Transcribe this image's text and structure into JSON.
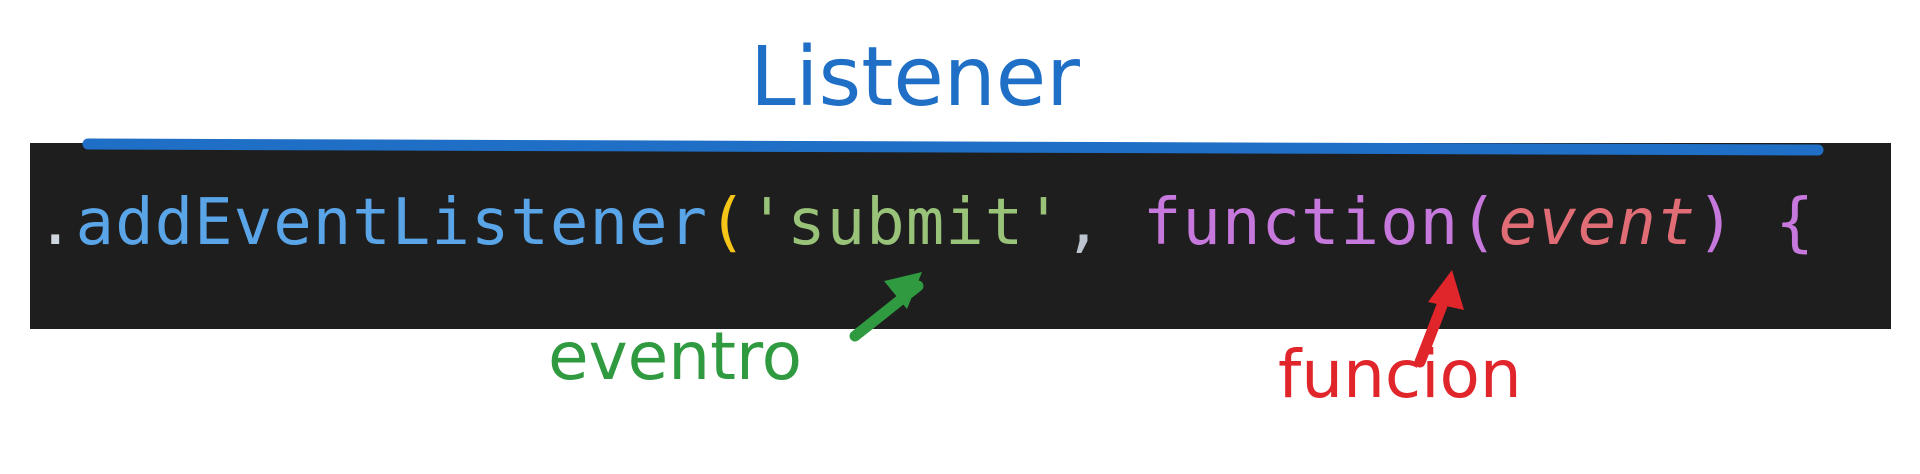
{
  "code": {
    "background": "#1e1e1e",
    "tokens": [
      {
        "text": ".",
        "color": "#cfd6de",
        "italic": false
      },
      {
        "text": "addEventListener",
        "color": "#5aa5e8",
        "italic": false
      },
      {
        "text": "(",
        "color": "#f5c518",
        "italic": false
      },
      {
        "text": "'submit'",
        "color": "#98c379",
        "italic": false
      },
      {
        "text": ", ",
        "color": "#bcc5cf",
        "italic": false
      },
      {
        "text": "function",
        "color": "#c678dd",
        "italic": false
      },
      {
        "text": "(",
        "color": "#c678dd",
        "italic": false
      },
      {
        "text": "event",
        "color": "#e06c75",
        "italic": true
      },
      {
        "text": ")",
        "color": "#c678dd",
        "italic": false
      },
      {
        "text": " ",
        "color": "#c678dd",
        "italic": false
      },
      {
        "text": "{",
        "color": "#c678dd",
        "italic": false
      }
    ]
  },
  "annotations": {
    "listener": {
      "text": "Listener",
      "color": "#1f6fc6"
    },
    "eventro": {
      "text": "eventro",
      "color": "#2f9a3f"
    },
    "funcion": {
      "text": "funcion",
      "color": "#e0252b"
    }
  }
}
